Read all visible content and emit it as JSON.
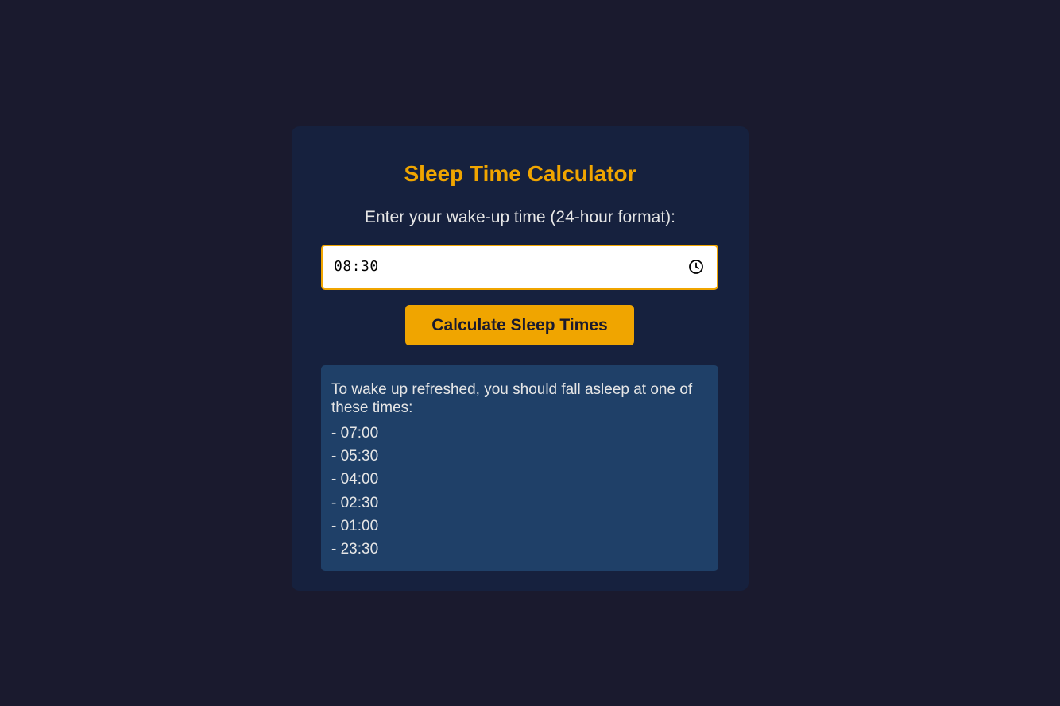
{
  "app": {
    "title": "Sleep Time Calculator",
    "prompt": "Enter your wake-up time (24-hour format):"
  },
  "input": {
    "value": "08:30",
    "icon": "clock-icon"
  },
  "button": {
    "label": "Calculate Sleep Times"
  },
  "result": {
    "intro": "To wake up refreshed, you should fall asleep at one of these times:",
    "times": [
      "- 07:00",
      "- 05:30",
      "- 04:00",
      "- 02:30",
      "- 01:00",
      "- 23:30"
    ]
  },
  "colors": {
    "background": "#1a1a2e",
    "card": "#16213e",
    "accent": "#f0a500",
    "result_panel": "#1f4068",
    "text": "#e6e6e6"
  }
}
